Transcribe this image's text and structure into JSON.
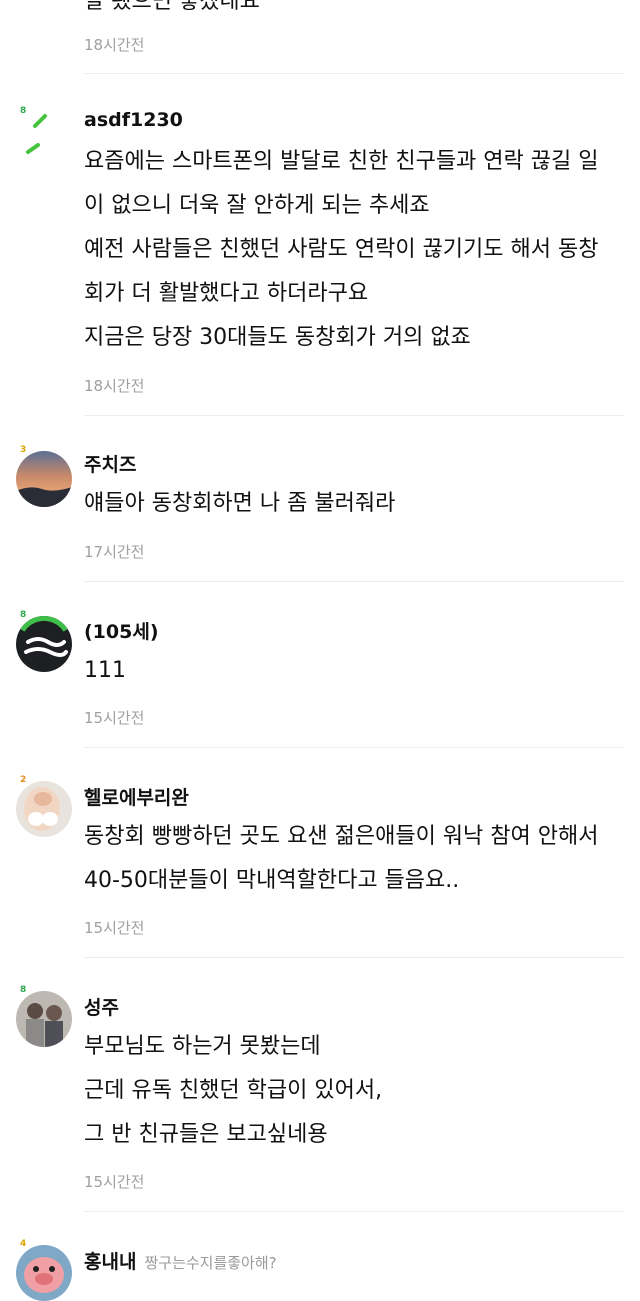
{
  "comments": [
    {
      "username": "",
      "lines": [
        "잘 됐으면 좋겠네요"
      ],
      "time": "18시간전"
    },
    {
      "username": "asdf1230",
      "level": "8",
      "lines": [
        "요즘에는 스마트폰의 발달로 친한 친구들과 연락 끊길 일",
        "이 없으니 더욱 잘 안하게 되는 추세죠",
        "예전 사람들은 친했던 사람도 연락이 끊기기도 해서 동창",
        "회가 더 활발했다고 하더라구요",
        "지금은 당장 30대들도 동창회가 거의 없죠"
      ],
      "time": "18시간전"
    },
    {
      "username": "주치즈",
      "level": "3",
      "lines": [
        "얘들아 동창회하면 나 좀 불러줘라"
      ],
      "time": "17시간전"
    },
    {
      "username": "(105세)",
      "level": "8",
      "lines": [
        "111"
      ],
      "time": "15시간전"
    },
    {
      "username": "헬로에부리완",
      "level": "2",
      "lines": [
        "동창회 빵빵하던 곳도 요샌 젊은애들이 워낙 참여 안해서",
        "40-50대분들이 막내역할한다고 들음요.."
      ],
      "time": "15시간전"
    },
    {
      "username": "성주",
      "level": "8",
      "lines": [
        "부모님도 하는거 못봤는데",
        "근데 유독 친했던 학급이 있어서,",
        "그 반 친규들은 보고싶네용"
      ],
      "time": "15시간전"
    },
    {
      "username": "홍내내",
      "level": "4",
      "badge": "짱구는수지를좋아해?",
      "lines": [],
      "time": ""
    }
  ]
}
